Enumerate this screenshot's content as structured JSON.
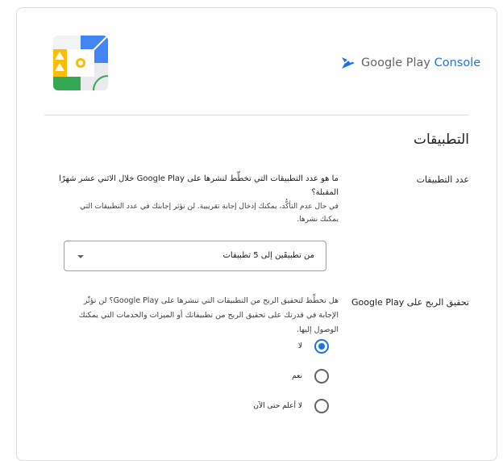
{
  "header": {
    "logo_google": "Google Play",
    "logo_console": "Console"
  },
  "section": {
    "title": "التطبيقات"
  },
  "apps_count": {
    "label": "عدد التطبيقات",
    "question": "ما هو عدد التطبيقات التي تخطِّط لنشرها على Google Play خلال الاثني عشر شهرًا المقبلة؟",
    "help": "في حال عدم التأكُّد، يمكنك إدخال إجابة تقريبية. لن تؤثر إجابتك في عدد التطبيقات التي يمكنك نشرها.",
    "selected": "من تطبيقَين إلى 5 تطبيقات"
  },
  "monetization": {
    "label": "تحقيق الربح على Google Play",
    "question": "هل تخطِّط لتحقيق الربح من التطبيقات التي تنشرها على Google Play؟ لن تؤثّر الإجابة في قدرتك على تحقيق الربح من تطبيقاتك أو الميزات والخدمات التي يمكنك الوصول إليها.",
    "options": [
      {
        "label": "لا",
        "selected": true
      },
      {
        "label": "نعم",
        "selected": false
      },
      {
        "label": "لا أعلم حتى الآن",
        "selected": false
      }
    ]
  },
  "colors": {
    "accent": "#1a73e8",
    "border": "#dadce0"
  }
}
